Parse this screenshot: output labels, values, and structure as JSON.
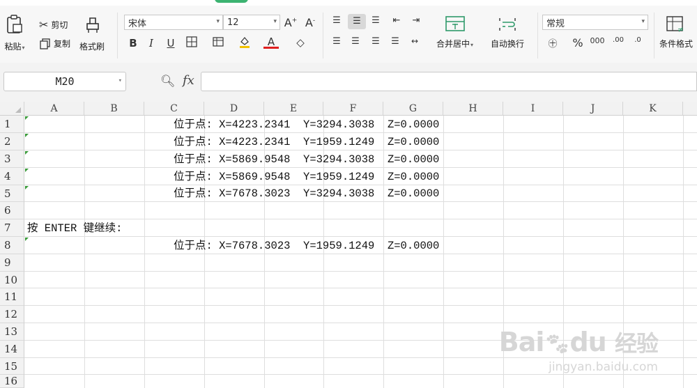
{
  "ribbon": {
    "paste_label": "粘贴",
    "cut_label": "剪切",
    "copy_label": "复制",
    "format_painter_label": "格式刷",
    "font_name": "宋体",
    "font_size": "12",
    "merge_center_label": "合并居中",
    "wrap_text_label": "自动换行",
    "number_format": "常规",
    "conditional_format_label": "条件格式"
  },
  "formula_bar": {
    "cell_ref": "M20",
    "fx_label": "fx",
    "formula": ""
  },
  "sheet": {
    "columns": [
      "A",
      "B",
      "C",
      "D",
      "E",
      "F",
      "G",
      "H",
      "I",
      "J",
      "K"
    ],
    "rows": [
      "1",
      "2",
      "3",
      "4",
      "5",
      "6",
      "7",
      "8",
      "9",
      "10",
      "11",
      "12",
      "13",
      "14",
      "15",
      "16"
    ],
    "cells": [
      {
        "row": "1",
        "text": "位于点: X=4223.2341  Y=3294.3038  Z=0.0000"
      },
      {
        "row": "2",
        "text": "位于点: X=4223.2341  Y=1959.1249  Z=0.0000"
      },
      {
        "row": "3",
        "text": "位于点: X=5869.9548  Y=3294.3038  Z=0.0000"
      },
      {
        "row": "4",
        "text": "位于点: X=5869.9548  Y=1959.1249  Z=0.0000"
      },
      {
        "row": "5",
        "text": "位于点: X=7678.3023  Y=3294.3038  Z=0.0000"
      },
      {
        "row": "7",
        "text": "按 ENTER 键继续:"
      },
      {
        "row": "8",
        "text": "位于点: X=7678.3023  Y=1959.1249  Z=0.0000"
      }
    ]
  },
  "watermark": {
    "brand": "Bai",
    "brand2": "du",
    "cn": "经验",
    "url": "jingyan.baidu.com"
  }
}
